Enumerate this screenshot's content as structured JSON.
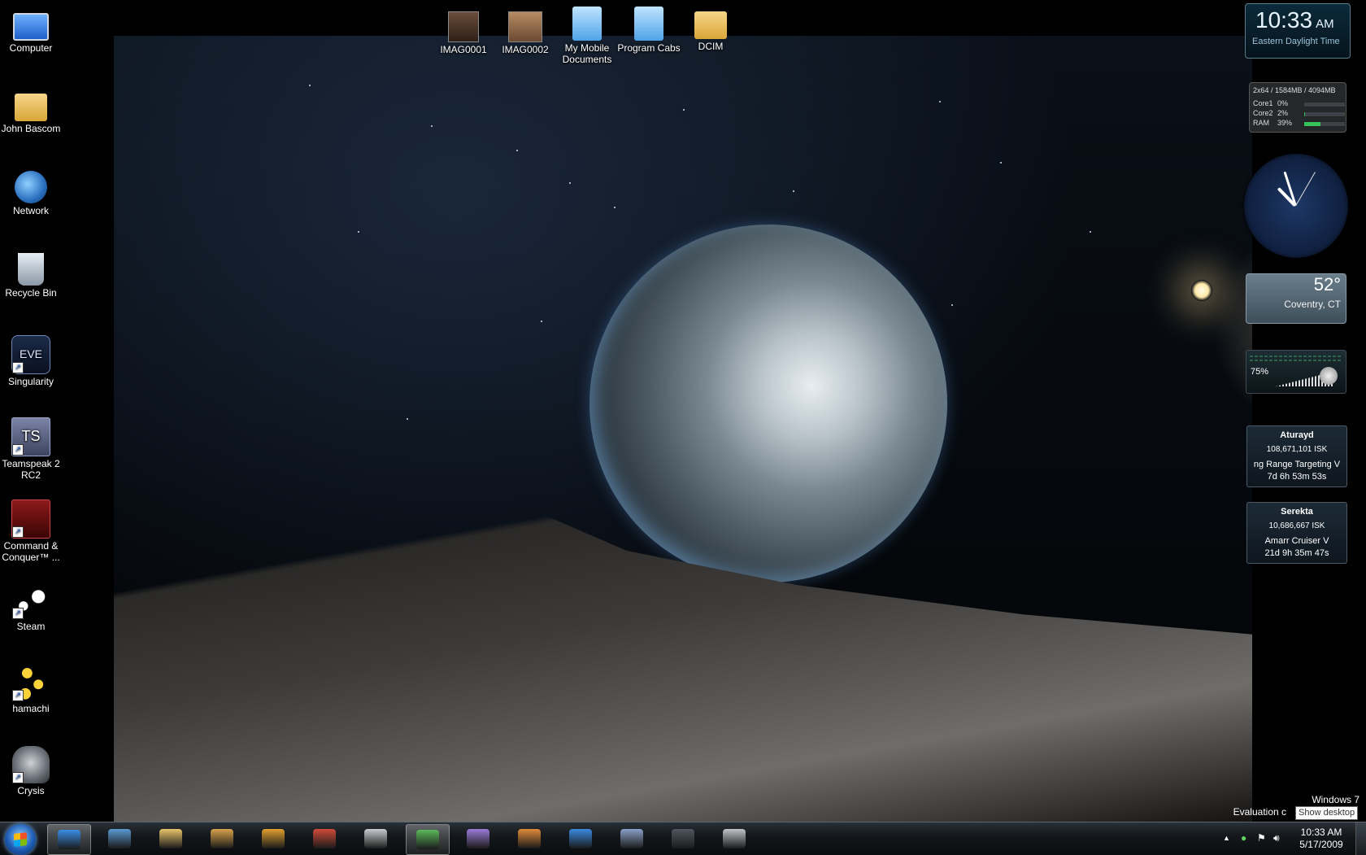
{
  "desktop_icons_left": [
    {
      "label": "Computer",
      "icon": "computer-icon",
      "shortcut": false
    },
    {
      "label": "John Bascom",
      "icon": "user-folder-icon",
      "shortcut": false
    },
    {
      "label": "Network",
      "icon": "network-icon",
      "shortcut": false
    },
    {
      "label": "Recycle Bin",
      "icon": "recycle-bin-icon",
      "shortcut": false
    },
    {
      "label": "Singularity",
      "icon": "eve-icon",
      "shortcut": true
    },
    {
      "label": "Teamspeak 2 RC2",
      "icon": "teamspeak-icon",
      "shortcut": true
    },
    {
      "label": "Command & Conquer™ ...",
      "icon": "command-conquer-icon",
      "shortcut": true
    },
    {
      "label": "Steam",
      "icon": "steam-icon",
      "shortcut": true
    },
    {
      "label": "hamachi",
      "icon": "hamachi-icon",
      "shortcut": true
    },
    {
      "label": "Crysis",
      "icon": "crysis-icon",
      "shortcut": true
    }
  ],
  "desktop_icons_top": [
    {
      "label": "IMAG0001",
      "icon": "photo-icon"
    },
    {
      "label": "IMAG0002",
      "icon": "photo-icon"
    },
    {
      "label": "My Mobile Documents",
      "icon": "folder-icon"
    },
    {
      "label": "Program Cabs",
      "icon": "folder-icon"
    },
    {
      "label": "DCIM",
      "icon": "folder-icon"
    }
  ],
  "gadgets": {
    "digital_clock": {
      "time": "10:33",
      "ampm": "AM",
      "zone": "Eastern Daylight Time"
    },
    "cpu_meter": {
      "header": "2x64 / 1584MB / 4094MB",
      "rows": [
        {
          "name": "Core1",
          "value": "0%",
          "level": 0.0
        },
        {
          "name": "Core2",
          "value": "2%",
          "level": 0.02
        },
        {
          "name": "RAM",
          "value": "39%",
          "level": 0.39
        }
      ]
    },
    "weather": {
      "temperature": "52°",
      "city": "Coventry, CT"
    },
    "volume": {
      "percent": "75%"
    },
    "eve_characters": [
      {
        "name": "Aturayd",
        "isk": "108,671,101 ISK",
        "skill": "ng Range Targeting V",
        "timer": "7d 6h 53m 53s"
      },
      {
        "name": "Serekta",
        "isk": "10,686,667 ISK",
        "skill": "Amarr Cruiser V",
        "timer": "21d 9h 35m 47s"
      }
    ]
  },
  "watermark": {
    "line1": "Windows 7",
    "line2": "Evaluation c"
  },
  "tooltip": "Show desktop",
  "taskbar": {
    "items": [
      {
        "icon": "internet-explorer-icon",
        "active": true
      },
      {
        "icon": "remote-desktop-icon",
        "active": false
      },
      {
        "icon": "windows-explorer-icon",
        "active": false
      },
      {
        "icon": "mail-icon",
        "active": false
      },
      {
        "icon": "media-player-icon",
        "active": false
      },
      {
        "icon": "game-icon",
        "active": false
      },
      {
        "icon": "headset-icon",
        "active": false
      },
      {
        "icon": "messenger-icon",
        "active": true
      },
      {
        "icon": "pidgin-icon",
        "active": false
      },
      {
        "icon": "photo-gallery-icon",
        "active": false
      },
      {
        "icon": "globe-icon",
        "active": false
      },
      {
        "icon": "eve-icon",
        "active": false
      },
      {
        "icon": "game-dark-icon",
        "active": false
      },
      {
        "icon": "steam-icon",
        "active": false
      }
    ],
    "tray": {
      "time": "10:33 AM",
      "date": "5/17/2009"
    }
  },
  "colors": {
    "taskbar_bg": "#14181c",
    "start_orb": "#1d5cb4",
    "ram_bar": "#35c35a"
  }
}
